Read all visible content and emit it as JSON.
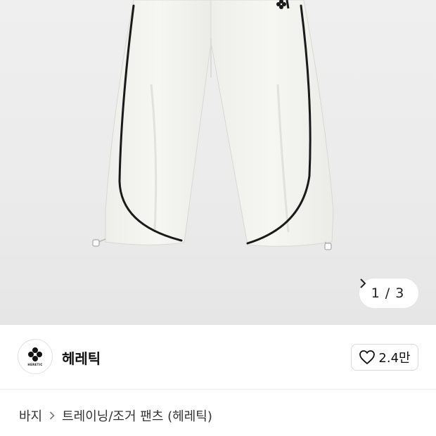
{
  "gallery": {
    "current": "1",
    "separator": "/",
    "total": "3",
    "next_icon": "chevron-right-icon"
  },
  "brand": {
    "name": "헤레틱",
    "logo_text": "HERETIC",
    "logo_icon": "clover-cross-icon"
  },
  "like": {
    "icon": "heart-outline-icon",
    "count": "2.4만"
  },
  "breadcrumb": {
    "category": "바지",
    "separator_icon": "chevron-right-icon",
    "subcategory": "트레이닝/조거 팬츠 (헤레틱)"
  },
  "colors": {
    "image_background": "#ececec",
    "pants_fabric": "#f3f3ef",
    "piping": "#1a1a1a"
  }
}
